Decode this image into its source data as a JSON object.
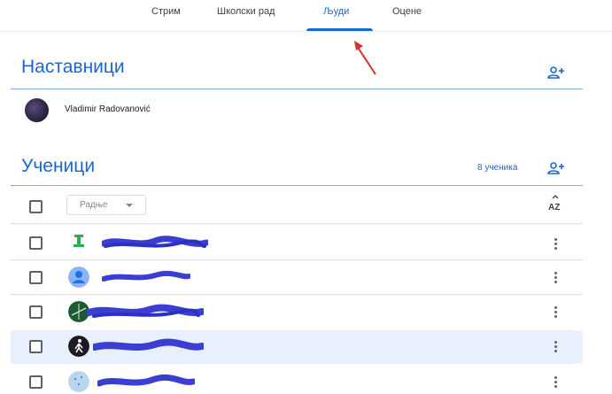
{
  "tabs": [
    {
      "label": "Стрим"
    },
    {
      "label": "Школски рад"
    },
    {
      "label": "Људи"
    },
    {
      "label": "Оцене"
    }
  ],
  "active_tab": "Људи",
  "accent_color": "#1967d2",
  "teachers": {
    "title": "Наставници",
    "add_icon": "person-add-icon",
    "list": [
      {
        "name": "Vladimir Radovanović"
      }
    ]
  },
  "students": {
    "title": "Ученици",
    "count": "8 ученика",
    "add_icon": "person-add-icon",
    "sort_select": {
      "value": "Радње",
      "icon": "caret-down-icon"
    },
    "sort_icon": "sort-az-icon",
    "rows": [
      {
        "avatar": "green-pin-avatar",
        "name_redacted": true,
        "highlighted": false
      },
      {
        "avatar": "default-person-avatar",
        "name_redacted": true,
        "highlighted": false
      },
      {
        "avatar": "green-photo-avatar",
        "name_redacted": true,
        "highlighted": false
      },
      {
        "avatar": "dark-figure-avatar",
        "name_redacted": true,
        "highlighted": true
      },
      {
        "avatar": "light-blue-avatar",
        "name_redacted": true,
        "highlighted": false
      }
    ]
  },
  "annotation": {
    "type": "red-arrow",
    "points_to": "Људи"
  }
}
